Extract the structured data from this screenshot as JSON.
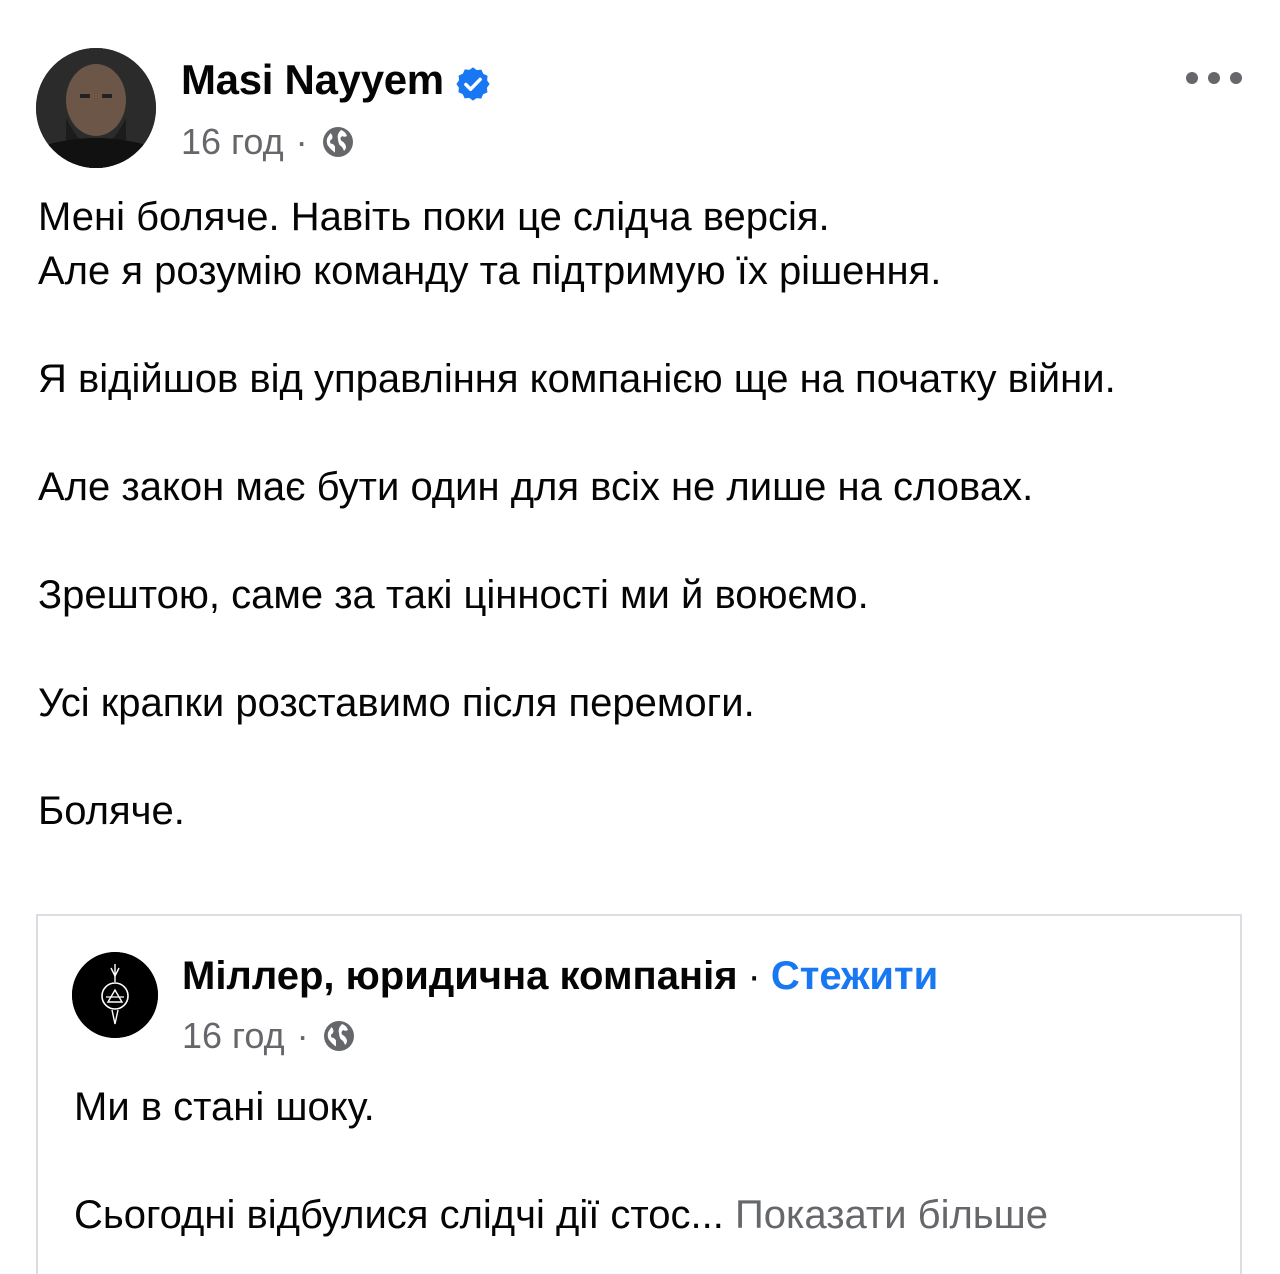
{
  "post": {
    "author": "Masi Nayyem",
    "time": "16 год",
    "separator": "·",
    "body": [
      "Мені боляче. Навіть поки це слідча версія.",
      "Але я розумію команду та підтримую їх рішення.",
      "Я відійшов від управління компанією ще на початку війни.",
      "Але закон має бути один для всіх не лише на словах.",
      "Зрештою, саме за такі цінності ми й воюємо.",
      "Усі крапки розставимо після перемоги.",
      "Боляче."
    ]
  },
  "shared_post": {
    "page_name": "Міллер, юридична компанія",
    "separator": "·",
    "follow_label": "Стежити",
    "time": "16 год",
    "body": [
      "Ми в стані шоку.",
      "Сьогодні відбулися слідчі дії стос..."
    ],
    "see_more_label": "Показати більше"
  },
  "colors": {
    "text": "#050505",
    "secondary": "#65676b",
    "accent": "#1877f2",
    "border": "#dadde1"
  },
  "icons": {
    "verified": "verified-badge-icon",
    "audience": "globe-icon",
    "menu": "more-options-icon"
  }
}
